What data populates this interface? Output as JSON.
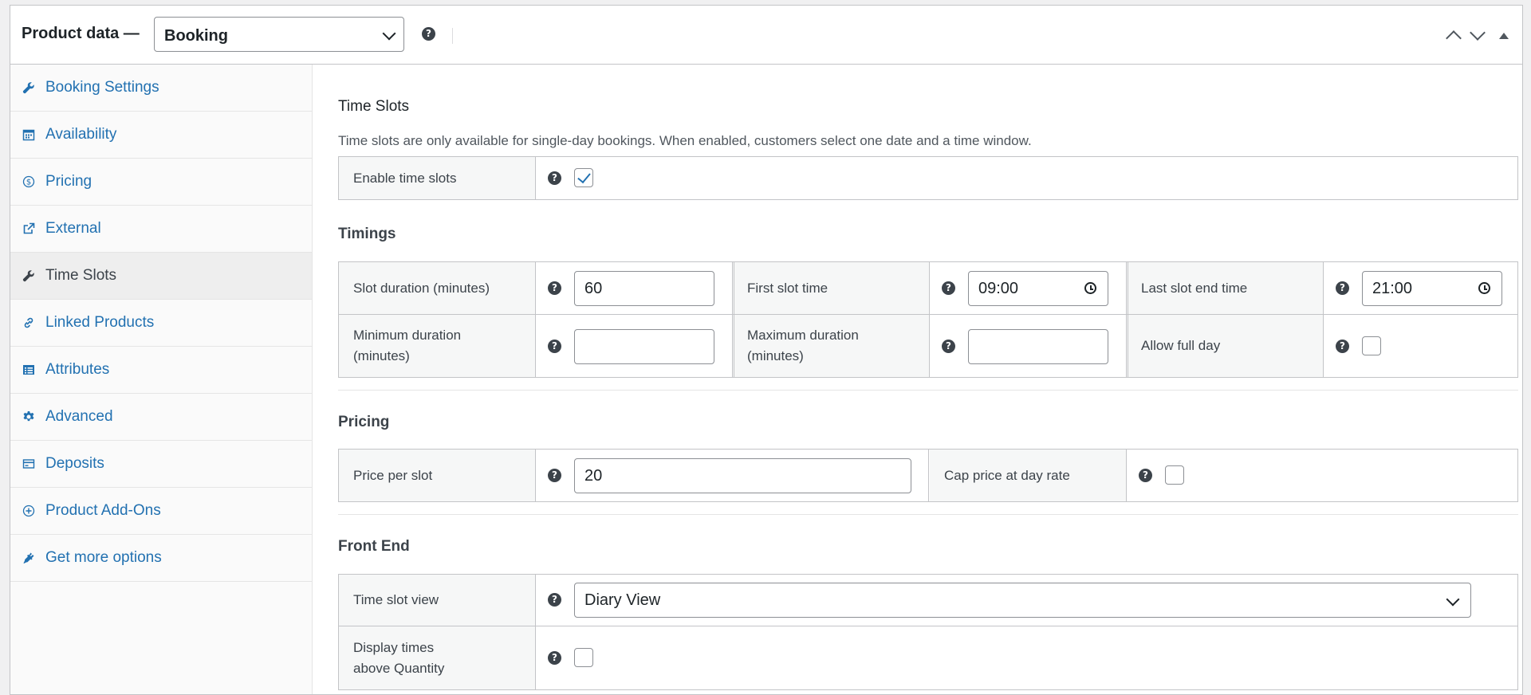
{
  "header": {
    "title": "Product data —",
    "product_type": "Booking"
  },
  "sidebar": {
    "items": [
      {
        "label": "Booking Settings",
        "icon": "wrench-icon"
      },
      {
        "label": "Availability",
        "icon": "calendar-icon"
      },
      {
        "label": "Pricing",
        "icon": "dollar-icon"
      },
      {
        "label": "External",
        "icon": "external-link-icon"
      },
      {
        "label": "Time Slots",
        "icon": "wrench-icon",
        "active": true
      },
      {
        "label": "Linked Products",
        "icon": "link-icon"
      },
      {
        "label": "Attributes",
        "icon": "list-icon"
      },
      {
        "label": "Advanced",
        "icon": "gear-icon"
      },
      {
        "label": "Deposits",
        "icon": "card-icon"
      },
      {
        "label": "Product Add-Ons",
        "icon": "plus-circle-icon"
      },
      {
        "label": "Get more options",
        "icon": "plugin-icon"
      }
    ]
  },
  "time_slots": {
    "heading": "Time Slots",
    "description": "Time slots are only available for single-day bookings. When enabled, customers select one date and a time window.",
    "enable_label": "Enable time slots",
    "enable_checked": true
  },
  "timings": {
    "heading": "Timings",
    "slot_duration_label": "Slot duration (minutes)",
    "slot_duration_value": "60",
    "first_slot_label": "First slot time",
    "first_slot_value": "09:00",
    "last_slot_label": "Last slot end time",
    "last_slot_value": "21:00",
    "min_duration_label_1": "Minimum duration",
    "min_duration_label_2": "(minutes)",
    "min_duration_value": "",
    "max_duration_label_1": "Maximum duration",
    "max_duration_label_2": "(minutes)",
    "max_duration_value": "",
    "allow_full_day_label": "Allow full day",
    "allow_full_day_checked": false
  },
  "pricing": {
    "heading": "Pricing",
    "price_per_slot_label": "Price per slot",
    "price_per_slot_value": "20",
    "cap_price_label": "Cap price at day rate",
    "cap_price_checked": false
  },
  "front_end": {
    "heading": "Front End",
    "view_label": "Time slot view",
    "view_value": "Diary View",
    "display_times_label_1": "Display times",
    "display_times_label_2": "above Quantity",
    "display_times_checked": false
  },
  "help_glyph": "?",
  "colors": {
    "link": "#2271b1",
    "border": "#c3c4c7",
    "label_bg": "#f6f7f7",
    "help_bg": "#3c434a"
  }
}
